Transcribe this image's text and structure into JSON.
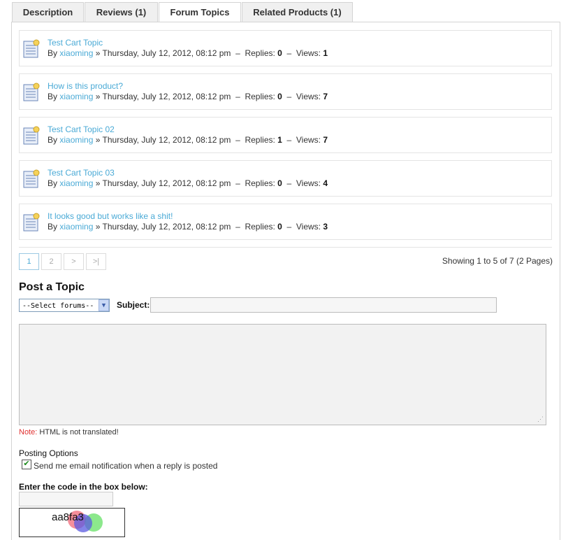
{
  "tabs": [
    {
      "label": "Description"
    },
    {
      "label": "Reviews (1)"
    },
    {
      "label": "Forum Topics"
    },
    {
      "label": "Related Products (1)"
    }
  ],
  "topics": [
    {
      "title": "Test Cart Topic",
      "by": "By",
      "author": "xiaoming",
      "sep": "»",
      "date": "Thursday, July 12, 2012, 08:12 pm",
      "dash": "–",
      "replies_label": "Replies:",
      "replies": "0",
      "views_label": "Views:",
      "views": "1"
    },
    {
      "title": "How is this product?",
      "by": "By",
      "author": "xiaoming",
      "sep": "»",
      "date": "Thursday, July 12, 2012, 08:12 pm",
      "dash": "–",
      "replies_label": "Replies:",
      "replies": "0",
      "views_label": "Views:",
      "views": "7"
    },
    {
      "title": "Test Cart Topic 02",
      "by": "By",
      "author": "xiaoming",
      "sep": "»",
      "date": "Thursday, July 12, 2012, 08:12 pm",
      "dash": "–",
      "replies_label": "Replies:",
      "replies": "1",
      "views_label": "Views:",
      "views": "7"
    },
    {
      "title": "Test Cart Topic 03",
      "by": "By",
      "author": "xiaoming",
      "sep": "»",
      "date": "Thursday, July 12, 2012, 08:12 pm",
      "dash": "–",
      "replies_label": "Replies:",
      "replies": "0",
      "views_label": "Views:",
      "views": "4"
    },
    {
      "title": "It looks good but works like a shit!",
      "by": "By",
      "author": "xiaoming",
      "sep": "»",
      "date": "Thursday, July 12, 2012, 08:12 pm",
      "dash": "–",
      "replies_label": "Replies:",
      "replies": "0",
      "views_label": "Views:",
      "views": "3"
    }
  ],
  "pagination": {
    "pages": [
      "1",
      "2",
      ">",
      ">|"
    ],
    "showing": "Showing 1 to 5 of 7 (2 Pages)"
  },
  "post": {
    "title": "Post a Topic",
    "forum_select_value": "--Select forums--",
    "subject_label": "Subject:",
    "subject_value": "",
    "note_label": "Note:",
    "note_text": "HTML is not translated!",
    "posting_options": "Posting Options",
    "email_notify_label": "Send me email notification when a reply is posted",
    "email_notify_checked": true,
    "code_label": "Enter the code in the box below:",
    "captcha_text": "aa8fa3"
  },
  "colors": {
    "link": "#4aaad6",
    "note": "#e03030"
  }
}
